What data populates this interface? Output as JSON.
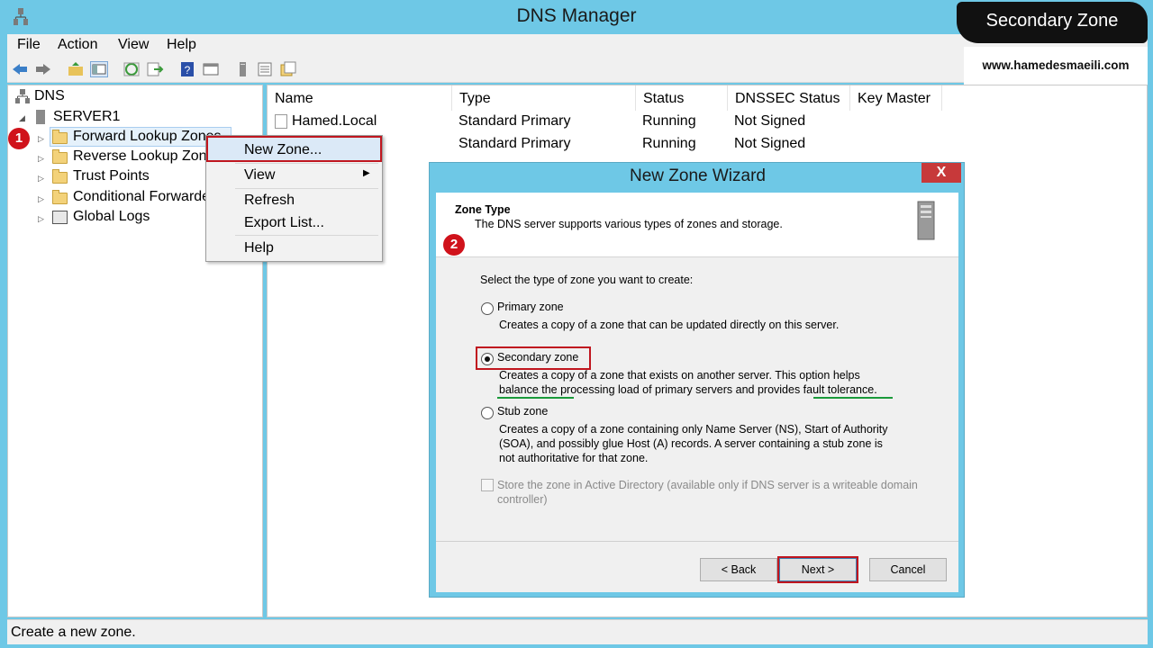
{
  "window": {
    "title": "DNS Manager"
  },
  "menubar": [
    "File",
    "Action",
    "View",
    "Help"
  ],
  "tree": {
    "root": "DNS",
    "server": "SERVER1",
    "items": [
      {
        "label": "Forward Lookup Zones"
      },
      {
        "label": "Reverse Lookup Zones"
      },
      {
        "label": "Trust Points"
      },
      {
        "label": "Conditional Forwarders"
      },
      {
        "label": "Global Logs"
      }
    ]
  },
  "list": {
    "columns": [
      "Name",
      "Type",
      "Status",
      "DNSSEC Status",
      "Key Master"
    ],
    "rows": [
      {
        "name": "Hamed.Local",
        "type": "Standard Primary",
        "status": "Running",
        "dnssec": "Not Signed"
      },
      {
        "name": "",
        "type": "Standard Primary",
        "status": "Running",
        "dnssec": "Not Signed"
      }
    ]
  },
  "context_menu": {
    "items": [
      "New Zone...",
      "View",
      "Refresh",
      "Export List...",
      "Help"
    ]
  },
  "wizard": {
    "title": "New Zone Wizard",
    "close": "X",
    "header_title": "Zone Type",
    "header_desc": "The DNS server supports various types of zones and storage.",
    "prompt": "Select the type of zone you want to create:",
    "options": [
      {
        "label": "Primary zone",
        "desc": [
          "Creates a copy of a zone that can be updated directly on this server."
        ]
      },
      {
        "label": "Secondary zone",
        "desc": [
          "Creates a copy of a zone that exists on another server. This option helps",
          "balance the processing load of primary servers and provides fault tolerance."
        ]
      },
      {
        "label": "Stub zone",
        "desc": [
          "Creates a copy of a zone containing only Name Server (NS), Start of Authority",
          "(SOA), and possibly glue Host (A) records. A server containing a stub zone is",
          "not authoritative for that zone."
        ]
      }
    ],
    "selected": "Secondary zone",
    "store_ad": [
      "Store the zone in Active Directory (available only if DNS server is a writeable domain",
      "controller)"
    ],
    "buttons": {
      "back": "< Back",
      "next": "Next >",
      "cancel": "Cancel"
    }
  },
  "annotations": {
    "badge1": "1",
    "badge2": "2"
  },
  "status": "Create a new zone.",
  "overlay": {
    "banner": "Secondary Zone",
    "website": "www.hamedesmaeili.com"
  },
  "colors": {
    "title_bar": "#6ec8e6",
    "highlight": "#c0161f",
    "underline": "#1a9a3a"
  }
}
